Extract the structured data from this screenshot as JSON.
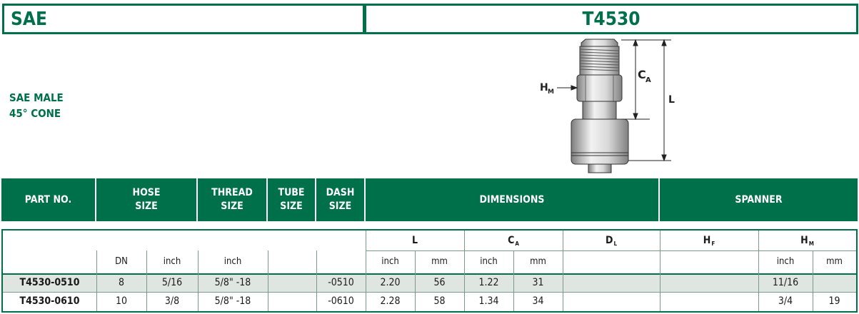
{
  "header": {
    "series": "SAE",
    "part": "T4530"
  },
  "subtitle": {
    "line1": "SAE MALE",
    "line2": "45° CONE"
  },
  "diagram": {
    "label_hm": "H",
    "label_hm_sub": "M",
    "label_ca": "C",
    "label_ca_sub": "A",
    "label_l": "L"
  },
  "columns": {
    "part_no": "PART NO.",
    "hose_size_1": "HOSE",
    "hose_size_2": "SIZE",
    "thread_size_1": "THREAD",
    "thread_size_2": "SIZE",
    "tube_size_1": "TUBE",
    "tube_size_2": "SIZE",
    "dash_size_1": "DASH",
    "dash_size_2": "SIZE",
    "dimensions": "DIMENSIONS",
    "spanner": "SPANNER"
  },
  "sub_headers": {
    "l": "L",
    "ca": "C",
    "ca_sub": "A",
    "dl": "D",
    "dl_sub": "L",
    "hf": "H",
    "hf_sub": "F",
    "hm": "H",
    "hm_sub": "M"
  },
  "units": {
    "dn": "DN",
    "hose_inch": "inch",
    "thread_inch": "inch",
    "l_inch": "inch",
    "l_mm": "mm",
    "ca_inch": "inch",
    "ca_mm": "mm",
    "hm_inch": "inch",
    "hm_mm": "mm"
  },
  "rows": [
    {
      "part": "T4530-0510",
      "dn": "8",
      "hose_inch": "5/16",
      "thread": "5/8\" -18",
      "tube": "",
      "dash": "-0510",
      "l_inch": "2.20",
      "l_mm": "56",
      "ca_inch": "1.22",
      "ca_mm": "31",
      "dl": "",
      "hf": "",
      "hm_inch": "11/16",
      "hm_mm": ""
    },
    {
      "part": "T4530-0610",
      "dn": "10",
      "hose_inch": "3/8",
      "thread": "5/8\" -18",
      "tube": "",
      "dash": "-0610",
      "l_inch": "2.28",
      "l_mm": "58",
      "ca_inch": "1.34",
      "ca_mm": "34",
      "dl": "",
      "hf": "",
      "hm_inch": "3/4",
      "hm_mm": "19"
    }
  ],
  "colors": {
    "brand_green": "#00704a",
    "row_shade": "#dfe6e2"
  }
}
